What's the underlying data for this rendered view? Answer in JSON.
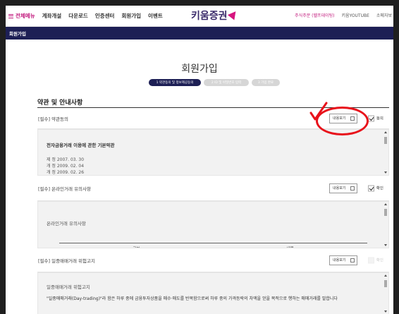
{
  "topnav": {
    "all_menu": "전체메뉴",
    "items": [
      "계좌개설",
      "다운로드",
      "인증센터",
      "회원가입",
      "이벤트"
    ],
    "logo": "키움증권",
    "right_links": [
      "주식주문 (헬프데이팅)",
      "키움YOUTUBE",
      "소메자보"
    ]
  },
  "subbar": {
    "title": "회원가입"
  },
  "page": {
    "title": "회원가입",
    "steps": [
      "1 약관동의 및 정보제공동의",
      "2 ID 및 비밀번호 입력",
      "3 가입 완료"
    ],
    "section_title": "약관 및 안내사항"
  },
  "rows": [
    {
      "label": "[필수] 약관동의",
      "button": "내용보기",
      "check_label": "동의",
      "checked": true
    },
    {
      "label": "[필수] 온라인거래 유의사항",
      "button": "내용보기",
      "check_label": "확인",
      "checked": true
    },
    {
      "label": "[필수] 일중매매거래 위험고지",
      "button": "내용보기",
      "check_label": "확인",
      "checked": false
    }
  ],
  "panels": {
    "terms": {
      "title": "전자금융거래 이용에 관한 기본약관",
      "lines": [
        "제 정 2007. 03. 30",
        "개 정 2009. 02. 04",
        "개 정 2009. 02. 26"
      ]
    },
    "online": {
      "title": "온라인거래 유의사항",
      "table_headers": [
        "구분",
        "내용"
      ]
    },
    "daytrade": {
      "title": "일중매매거래 위험고지",
      "body": "\"일중매매거래(Day-trading)\"라 함은 하루 중에 금융투자상품을 매수·매도를 반복함으로써 하루 중의 가격등락의 차액을 얻을 목적으로 행하는 매매거래를 말합니다"
    }
  },
  "colors": {
    "brand_navy": "#1d1f55",
    "brand_pink": "#c0157a",
    "annotation_red": "#e8121b"
  }
}
